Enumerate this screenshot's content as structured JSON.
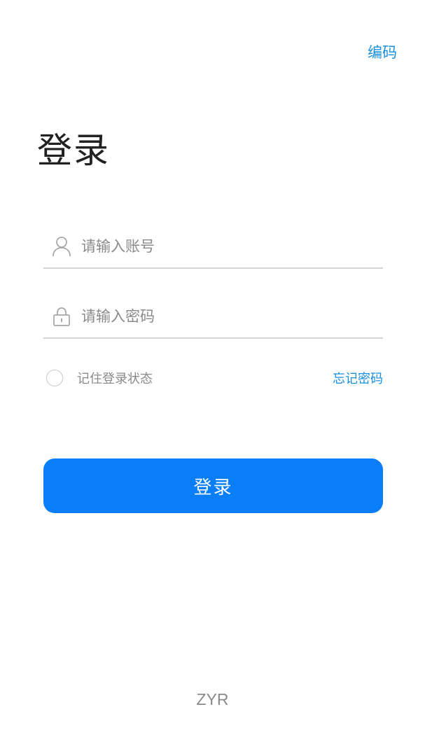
{
  "header": {
    "top_link": "编码"
  },
  "title": "登录",
  "form": {
    "account": {
      "placeholder": "请输入账号",
      "value": "",
      "icon": "user-icon"
    },
    "password": {
      "placeholder": "请输入密码",
      "value": "",
      "icon": "lock-icon"
    },
    "remember_label": "记住登录状态",
    "remember_checked": false,
    "forgot_label": "忘记密码",
    "submit_label": "登录"
  },
  "footer": {
    "text": "ZYR"
  },
  "colors": {
    "accent": "#0a7ef8",
    "link": "#1a8fe0",
    "placeholder": "#8a8a8a",
    "divider": "#d4d4d4"
  }
}
